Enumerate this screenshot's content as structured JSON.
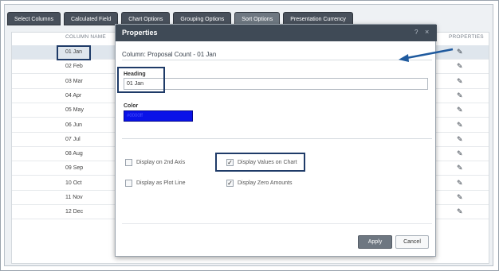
{
  "tabs": [
    "Select Columns",
    "Calculated Field",
    "Chart Options",
    "Grouping Options",
    "Sort Options",
    "Presentation Currency"
  ],
  "grid": {
    "column_name_header": "COLUMN NAME",
    "properties_header": "PROPERTIES",
    "rows": [
      "01 Jan",
      "02 Feb",
      "03 Mar",
      "04 Apr",
      "05 May",
      "06 Jun",
      "07 Jul",
      "08 Aug",
      "09 Sep",
      "10 Oct",
      "11 Nov",
      "12 Dec"
    ],
    "selected_index": 0,
    "edit_icon": "pencil-icon"
  },
  "dialog": {
    "title": "Properties",
    "help_label": "?",
    "close_label": "×",
    "column_title": "Column: Proposal Count - 01 Jan",
    "heading_label": "Heading",
    "heading_value": "01 Jan",
    "color_label": "Color",
    "color_value": "#0000ff",
    "color_hex": "#0a12e8",
    "options": {
      "display_2nd_axis": {
        "label": "Display on 2nd Axis",
        "checked": false
      },
      "display_values_on_chart": {
        "label": "Display Values on Chart",
        "checked": true
      },
      "display_plot_line": {
        "label": "Display as Plot Line",
        "checked": false
      },
      "display_zero_amounts": {
        "label": "Display Zero Amounts",
        "checked": true
      }
    },
    "apply_label": "Apply",
    "cancel_label": "Cancel"
  }
}
